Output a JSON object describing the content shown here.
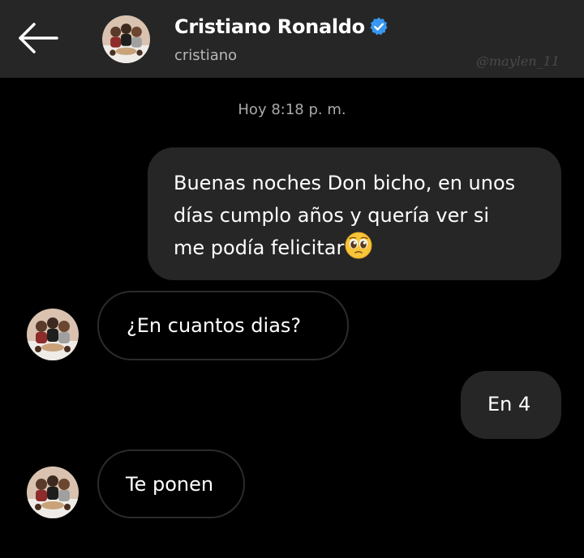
{
  "header": {
    "back_icon": "arrow-left-icon",
    "display_name": "Cristiano Ronaldo",
    "verified_icon": "verified-badge-icon",
    "username": "cristiano",
    "watermark": "@maylen_11"
  },
  "chat": {
    "timestamp": "Hoy 8:18 p. m.",
    "messages": [
      {
        "sender": "me",
        "lines": [
          "Buenas noches Don bicho, en unos",
          "días cumplo años y quería ver si",
          "me podía felicitar"
        ],
        "emoji": "pleading-face-emoji"
      },
      {
        "sender": "them",
        "text": "¿En cuantos dias?"
      },
      {
        "sender": "me",
        "text": "En 4"
      },
      {
        "sender": "them",
        "text": "Te ponen"
      }
    ]
  },
  "colors": {
    "background": "#000000",
    "header": "#262626",
    "outgoing_bubble": "#262626",
    "incoming_border": "#2b2b2b",
    "verified": "#3897f0"
  }
}
